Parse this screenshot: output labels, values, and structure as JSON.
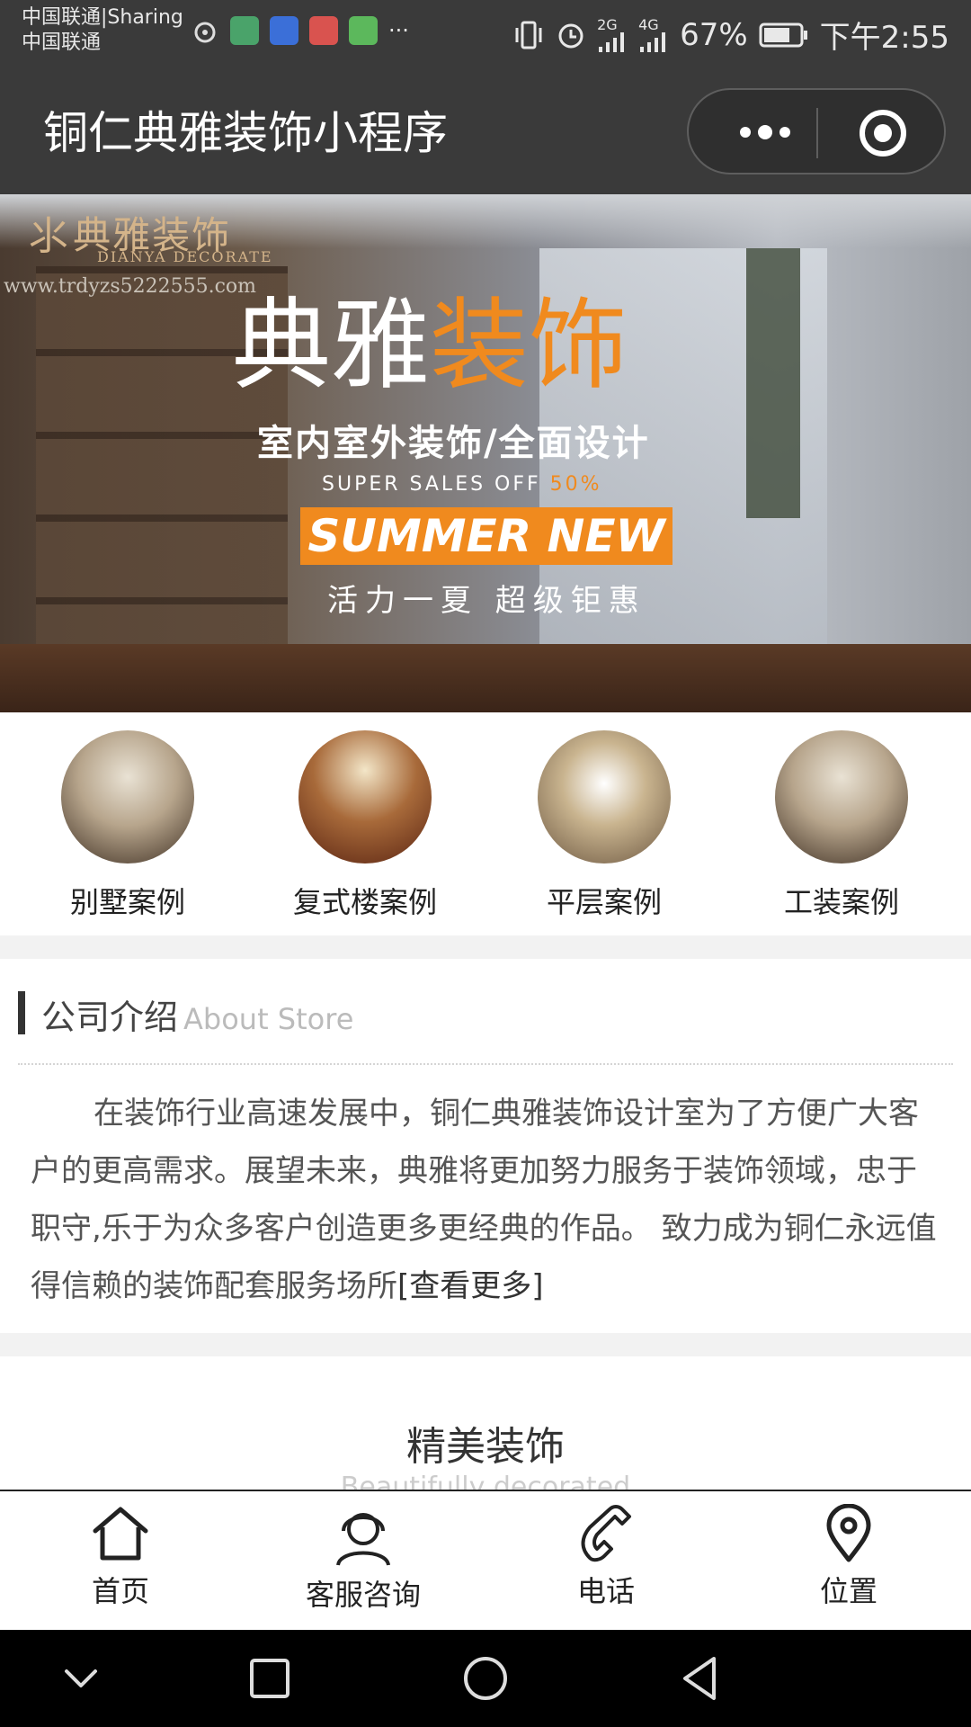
{
  "status_bar": {
    "carrier_line1": "中国联通|Sharing",
    "carrier_line2": "中国联通",
    "more_apps": "···",
    "net_2g": "2G",
    "net_4g": "4G",
    "battery": "67%",
    "time": "下午2:55"
  },
  "title_bar": {
    "title": "铜仁典雅装饰小程序"
  },
  "banner": {
    "logo_cn": "典雅装饰",
    "logo_en": "DIANYA DECORATE",
    "url": "www.trdyzs5222555.com",
    "headline_white": "典雅",
    "headline_orange": "装饰",
    "sub1": "室内室外装饰/全面设计",
    "sub2": "SUPER SALES OFF ",
    "sub2_pct": "50%",
    "badge": "SUMMER NEW",
    "sub3": "活力一夏 超级钜惠"
  },
  "categories": [
    {
      "label": "别墅案例"
    },
    {
      "label": "复式楼案例"
    },
    {
      "label": "平层案例"
    },
    {
      "label": "工装案例"
    }
  ],
  "about": {
    "title": "公司介绍",
    "title_en": "About Store",
    "text": "在装饰行业高速发展中，铜仁典雅装饰设计室为了方便广大客户的更高需求。展望未来，典雅将更加努力服务于装饰领域，忠于职守,乐于为众多客户创造更多更经典的作品。 致力成为铜仁永远值得信赖的装饰配套服务场所",
    "more": "[查看更多]"
  },
  "featured": {
    "title": "精美装饰",
    "subtitle": "Beautifully decorated"
  },
  "tabbar": [
    {
      "label": "首页",
      "icon": "home-icon"
    },
    {
      "label": "客服咨询",
      "icon": "customer-service-icon"
    },
    {
      "label": "电话",
      "icon": "phone-icon"
    },
    {
      "label": "位置",
      "icon": "location-icon"
    }
  ],
  "colors": {
    "header_bg": "#3a3a3a",
    "accent_orange": "#f08a1e",
    "section_gap": "#f2f2f2"
  }
}
